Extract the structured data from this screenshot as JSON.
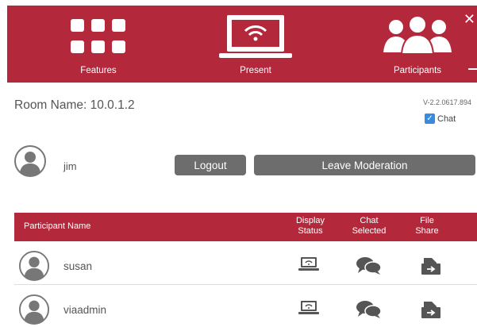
{
  "nav": {
    "features_label": "Features",
    "present_label": "Present",
    "participants_label": "Participants"
  },
  "window": {
    "close_glyph": "✕"
  },
  "room": {
    "name": "Room Name: 10.0.1.2",
    "version": "V-2.2.0617.894",
    "chat_label": "Chat",
    "chat_checked": true
  },
  "user": {
    "name": "jim",
    "logout_label": "Logout",
    "leave_label": "Leave Moderation"
  },
  "table": {
    "headers": {
      "name": "Participant Name",
      "display_line1": "Display",
      "display_line2": "Status",
      "chat_line1": "Chat",
      "chat_line2": "Selected",
      "file_line1": "File",
      "file_line2": "Share"
    },
    "rows": [
      {
        "name": "susan"
      },
      {
        "name": "viaadmin"
      }
    ]
  },
  "colors": {
    "brand_red": "#b3293b",
    "button_gray": "#6d6d6d",
    "checkbox_blue": "#3a8be0"
  },
  "icons": {
    "features": "grid-icon",
    "present": "laptop-wifi-icon",
    "participants": "people-group-icon",
    "display_status": "laptop-wifi-icon",
    "chat_selected": "chat-bubbles-icon",
    "file_share": "file-share-icon",
    "avatar": "user-avatar-icon"
  }
}
